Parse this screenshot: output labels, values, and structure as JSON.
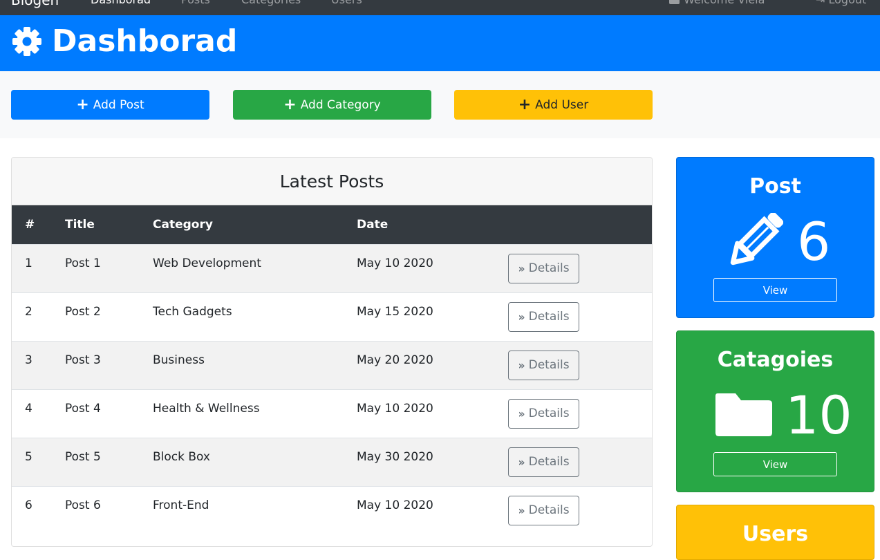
{
  "navbar": {
    "brand": "Blogen",
    "items": [
      {
        "label": "Dashborad",
        "active": true
      },
      {
        "label": "Posts"
      },
      {
        "label": "Categories"
      },
      {
        "label": "Users"
      }
    ],
    "welcome": "Welcome Viela",
    "logout": "Logout"
  },
  "header": {
    "title": "Dashborad",
    "icon": "gear-icon",
    "bg_color": "#007bff"
  },
  "actions": {
    "add_post": "Add Post",
    "add_category": "Add Category",
    "add_user": "Add User",
    "plus": "+",
    "colors": {
      "post": "#007bff",
      "category": "#28a745",
      "user": "#ffc107"
    }
  },
  "latest_posts": {
    "title": "Latest Posts",
    "columns": [
      "#",
      "Title",
      "Category",
      "Date",
      ""
    ],
    "rows": [
      {
        "num": "1",
        "title": "Post 1",
        "category": "Web Development",
        "date": "May 10 2020",
        "action": "Details"
      },
      {
        "num": "2",
        "title": "Post 2",
        "category": "Tech Gadgets",
        "date": "May 15 2020",
        "action": "Details"
      },
      {
        "num": "3",
        "title": "Post 3",
        "category": "Business",
        "date": "May 20 2020",
        "action": "Details"
      },
      {
        "num": "4",
        "title": "Post 4",
        "category": "Health & Wellness",
        "date": "May 10 2020",
        "action": "Details"
      },
      {
        "num": "5",
        "title": "Post 5",
        "category": "Block Box",
        "date": "May 30 2020",
        "action": "Details"
      },
      {
        "num": "6",
        "title": "Post 6",
        "category": "Front-End",
        "date": "May 10 2020",
        "action": "Details"
      }
    ]
  },
  "stats": {
    "posts": {
      "title": "Post",
      "count": "6",
      "button": "View",
      "icon": "pencil-icon",
      "color": "#007bff"
    },
    "categories": {
      "title": "Catagoies",
      "count": "10",
      "button": "View",
      "icon": "folder-icon",
      "color": "#28a745"
    },
    "users": {
      "title": "Users",
      "color": "#ffc107"
    }
  }
}
